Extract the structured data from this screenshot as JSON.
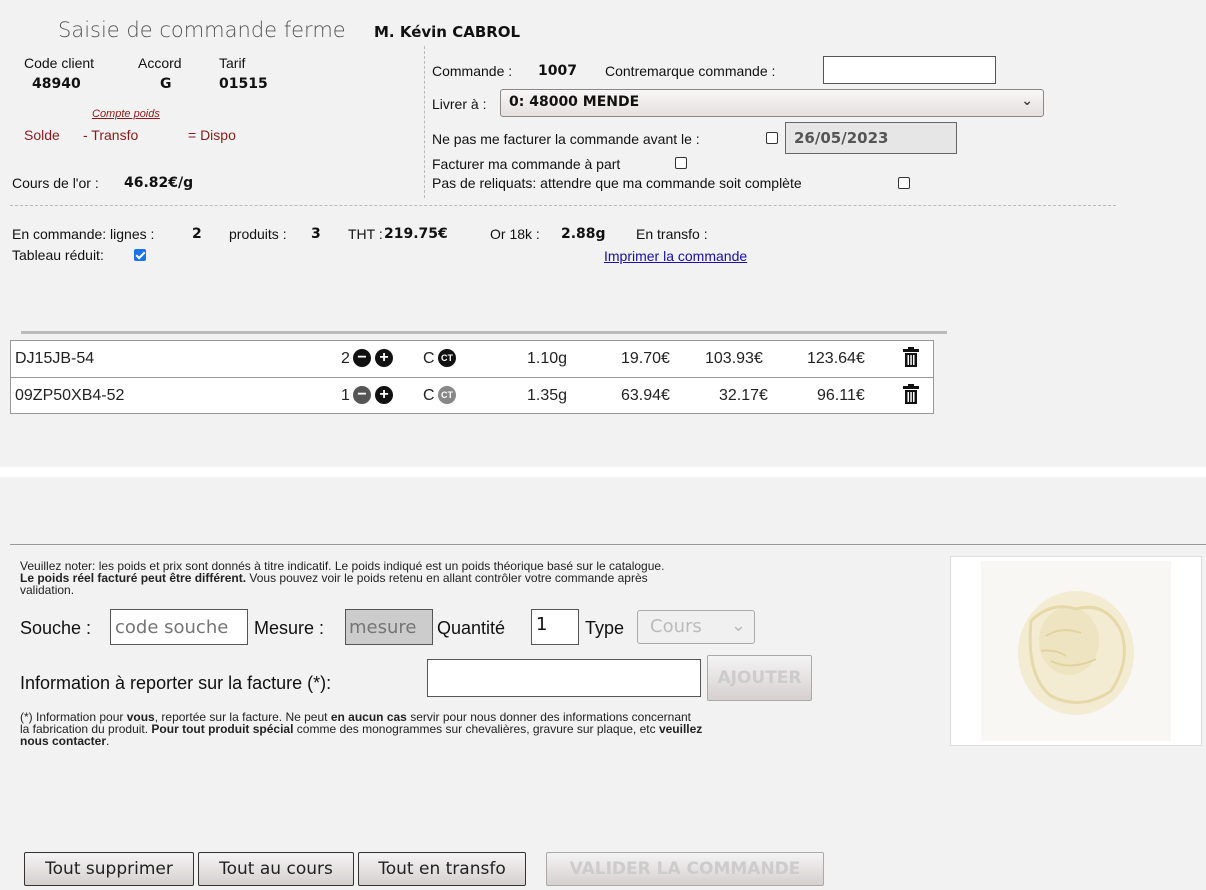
{
  "header": {
    "title": "Saisie de commande ferme",
    "client_name": "M. Kévin CABROL"
  },
  "client": {
    "code_label": "Code client",
    "code_value": "48940",
    "accord_label": "Accord",
    "accord_value": "G",
    "tarif_label": "Tarif",
    "tarif_value": "01515",
    "compte_poids": "Compte poids",
    "solde": "Solde",
    "transfo": "- Transfo",
    "dispo": "= Dispo",
    "cours_label": "Cours de l'or :",
    "cours_value": "46.82€/g"
  },
  "order": {
    "commande_label": "Commande :",
    "commande_value": "1007",
    "contremarque_label": "Contremarque commande :",
    "contremarque_value": "",
    "livrer_label": "Livrer à :",
    "livrer_value": "0: 48000 MENDE",
    "no_invoice_before_label": "Ne pas me facturer la commande avant le :",
    "no_invoice_before_checked": false,
    "date_value": "26/05/2023",
    "separate_invoice_label": "Facturer ma commande à part",
    "separate_invoice_checked": false,
    "no_backorder_label": "Pas de reliquats: attendre que ma commande soit complète",
    "no_backorder_checked": false
  },
  "summary": {
    "lignes_label": "En commande: lignes :",
    "lignes_value": "2",
    "produits_label": "produits :",
    "produits_value": "3",
    "tht_label": "THT :",
    "tht_value": "219.75€",
    "or_label": "Or 18k :",
    "or_value": "2.88g",
    "transfo_label": "En transfo :",
    "tableau_label": "Tableau réduit:",
    "tableau_checked": true,
    "print_link": "Imprimer la commande"
  },
  "lines": [
    {
      "ref": "DJ15JB-54",
      "qty": "2",
      "type": "C",
      "weight": "1.10g",
      "price1": "19.70€",
      "price2": "103.93€",
      "total": "123.64€",
      "badge": "CT"
    },
    {
      "ref": "09ZP50XB4-52",
      "qty": "1",
      "type": "C",
      "weight": "1.35g",
      "price1": "63.94€",
      "price2": "32.17€",
      "total": "96.11€",
      "badge": "CT"
    }
  ],
  "add_form": {
    "note_line1": "Veuillez noter: les poids et prix sont donnés à titre indicatif. Le poids indiqué est un poids théorique basé sur le catalogue.",
    "note_line2_bold": "Le poids réel facturé peut être différent.",
    "note_line2_rest": " Vous pouvez voir le poids retenu en allant contrôler votre commande après",
    "note_line3": "validation.",
    "souche_label": "Souche :",
    "souche_placeholder": "code souche",
    "mesure_label": "Mesure :",
    "mesure_placeholder": "mesure",
    "quantite_label": "Quantité",
    "quantite_value": "1",
    "type_label": "Type",
    "type_value": "Cours",
    "info_label": "Information à reporter sur la facture (*):",
    "info_value": "",
    "add_button": "AJOUTER",
    "footnote_a": "(*) Information pour ",
    "footnote_b": "vous",
    "footnote_c": ", reportée sur la facture. Ne peut ",
    "footnote_d": "en aucun cas",
    "footnote_e": " servir pour nous donner des informations concernant",
    "footnote_f": "la fabrication du produit. ",
    "footnote_g": "Pour tout produit spécial",
    "footnote_h": " comme des monogrammes sur chevalières, gravure sur plaque, etc ",
    "footnote_i": "veuillez",
    "footnote_j": "nous contacter",
    "footnote_k": "."
  },
  "actions": {
    "delete_all": "Tout supprimer",
    "all_cours": "Tout au cours",
    "all_transfo": "Tout en transfo",
    "validate": "VALIDER LA COMMANDE"
  },
  "colors": {
    "maroon": "#8a1a1a",
    "link": "#1a0dab",
    "checkbox_accent": "#1a73e8"
  }
}
